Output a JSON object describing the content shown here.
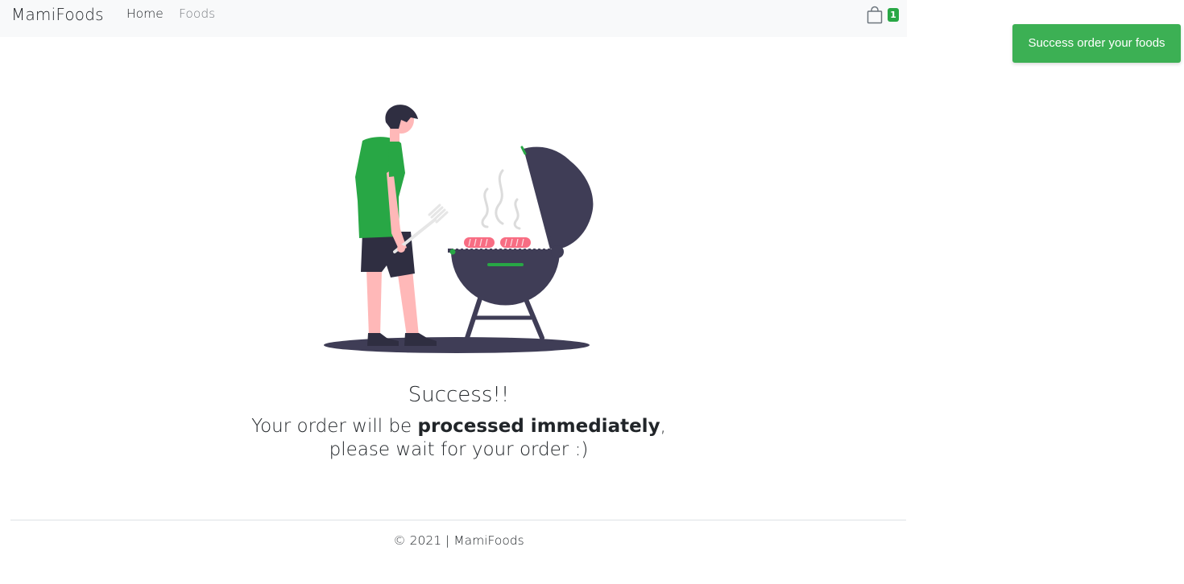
{
  "navbar": {
    "brand": "MamiFoods",
    "links": [
      "Home",
      "Foods"
    ],
    "cart": {
      "icon": "shopping-bag-icon",
      "count": "1",
      "badge_color": "#28a745"
    }
  },
  "toast": {
    "message": "Success order your foods",
    "color": "#3cb054"
  },
  "main": {
    "illustration": "man-grilling-barbecue-illustration",
    "title": "Success!!",
    "message_prefix": "Your order will be ",
    "message_strong": "processed immediately",
    "message_suffix": ",",
    "message_line2": "please wait for your order :)"
  },
  "footer": {
    "text": "© 2021 | MamiFoods"
  },
  "colors": {
    "accent": "#28a745",
    "navbar_bg": "#f8f9fa",
    "grill": "#3f3d56",
    "skin": "#ffb8b8",
    "meat": "#f86d83"
  }
}
